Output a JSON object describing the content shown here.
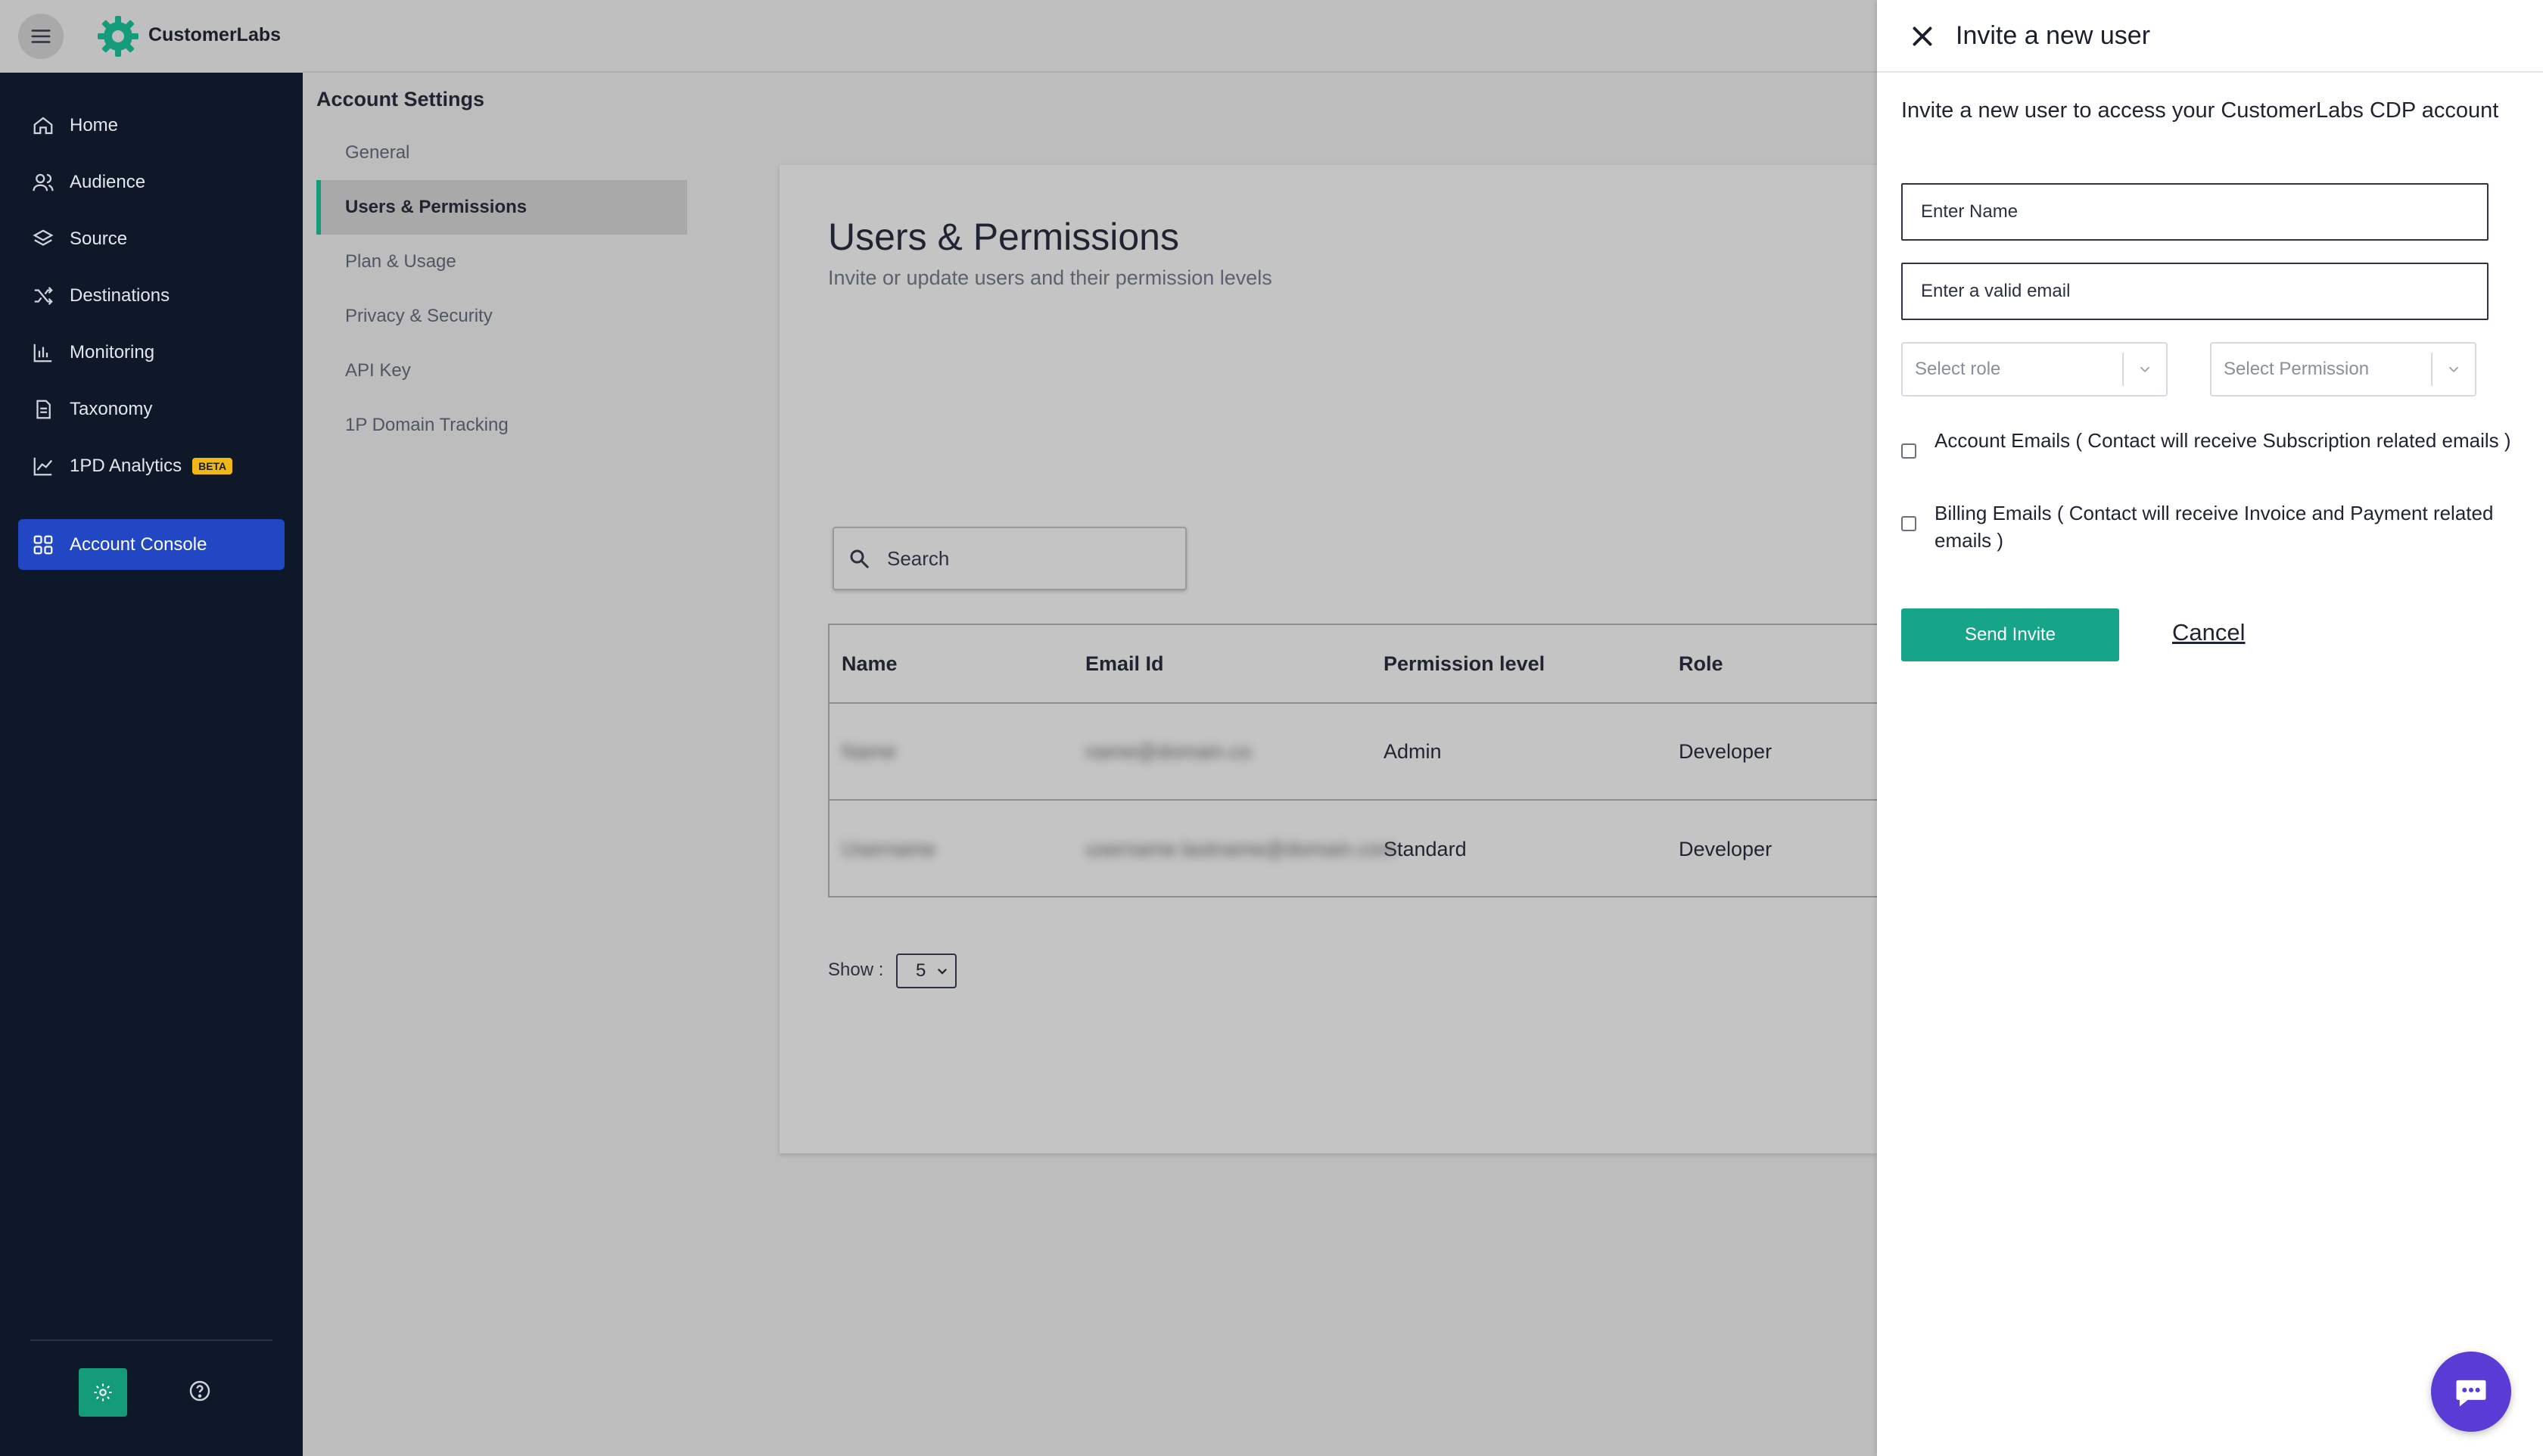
{
  "brand": {
    "name": "CustomerLabs"
  },
  "sidebar": {
    "items": [
      {
        "label": "Home",
        "icon": "home-icon"
      },
      {
        "label": "Audience",
        "icon": "users-icon"
      },
      {
        "label": "Source",
        "icon": "layers-icon"
      },
      {
        "label": "Destinations",
        "icon": "shuffle-icon"
      },
      {
        "label": "Monitoring",
        "icon": "bar-chart-icon"
      },
      {
        "label": "Taxonomy",
        "icon": "document-icon"
      },
      {
        "label": "1PD Analytics",
        "icon": "trend-icon",
        "badge": "BETA"
      }
    ],
    "active": {
      "label": "Account Console",
      "icon": "grid-icon"
    }
  },
  "settings": {
    "title": "Account Settings",
    "items": [
      "General",
      "Users & Permissions",
      "Plan & Usage",
      "Privacy & Security",
      "API Key",
      "1P Domain Tracking"
    ],
    "active_index": 1
  },
  "main": {
    "title": "Users & Permissions",
    "subtitle": "Invite or update users and their permission levels",
    "search_placeholder": "Search",
    "table": {
      "headers": [
        "Name",
        "Email Id",
        "Permission level",
        "Role"
      ],
      "rows": [
        {
          "name": "Name",
          "email": "name@domain.co",
          "permission": "Admin",
          "role": "Developer"
        },
        {
          "name": "Username",
          "email": "username.lastname@domain.com",
          "permission": "Standard",
          "role": "Developer"
        }
      ]
    },
    "show_label": "Show :",
    "show_value": "5"
  },
  "panel": {
    "title": "Invite a new user",
    "intro": "Invite a new user to access your CustomerLabs CDP account",
    "name_placeholder": "Enter Name",
    "email_placeholder": "Enter a valid email",
    "role_placeholder": "Select role",
    "permission_placeholder": "Select Permission",
    "account_emails_label": "Account Emails ( Contact will receive Subscription related emails )",
    "billing_emails_label": "Billing Emails ( Contact will receive Invoice and Payment related emails )",
    "send_label": "Send Invite",
    "cancel_label": "Cancel"
  },
  "colors": {
    "sidebar_bg": "#0f1828",
    "active_nav": "#2147c4",
    "accent_green": "#17a589",
    "chat_purple": "#5a3bd6",
    "beta_badge": "#f0b816"
  }
}
